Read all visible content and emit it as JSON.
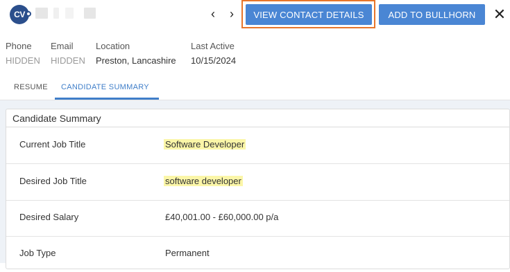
{
  "header": {
    "logo_text": "CV",
    "prev_icon": "chevron-left-icon",
    "next_icon": "chevron-right-icon",
    "view_contact_label": "VIEW CONTACT DETAILS",
    "add_bullhorn_label": "ADD TO BULLHORN",
    "close_icon": "close-icon",
    "accent_color": "#4a86d4",
    "highlight_color": "#e8752a"
  },
  "info": {
    "phone_label": "Phone",
    "phone_value": "HIDDEN",
    "email_label": "Email",
    "email_value": "HIDDEN",
    "location_label": "Location",
    "location_value": "Preston, Lancashire",
    "last_active_label": "Last Active",
    "last_active_value": "10/15/2024"
  },
  "tabs": {
    "resume": "RESUME",
    "summary": "CANDIDATE SUMMARY",
    "active": "CANDIDATE SUMMARY"
  },
  "summary": {
    "title": "Candidate Summary",
    "rows": [
      {
        "label": "Current Job Title",
        "value": "Software Developer",
        "highlighted": true
      },
      {
        "label": "Desired Job Title",
        "value": "software developer",
        "highlighted": true
      },
      {
        "label": "Desired Salary",
        "value": "£40,001.00 - £60,000.00 p/a",
        "highlighted": false
      },
      {
        "label": "Job Type",
        "value": "Permanent",
        "highlighted": false
      }
    ]
  }
}
